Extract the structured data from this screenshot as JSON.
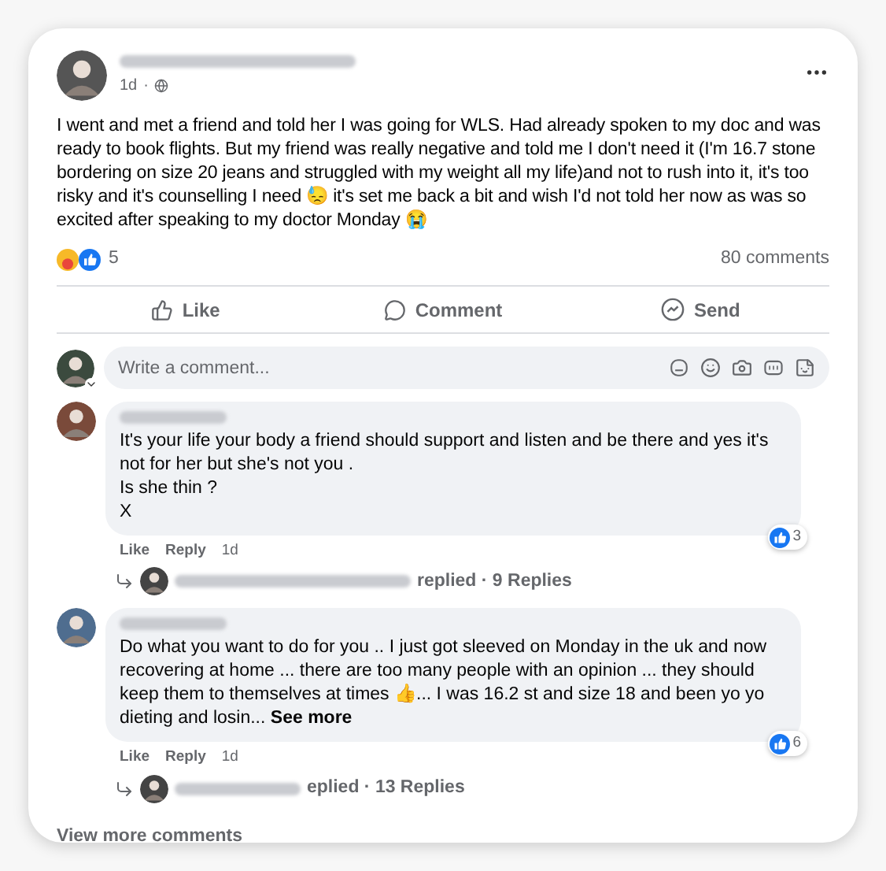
{
  "post": {
    "time": "1d",
    "separator": "·",
    "text": "I went and met a friend and told her I was going for WLS. Had already spoken to my doc and was ready to book flights. But my friend was really negative and told me I don't need it (I'm 16.7 stone bordering on size 20 jeans and struggled with my weight all my life)and not to rush into it, it's too risky and it's counselling I need 😓 it's set me back a bit and wish I'd not told her now as was so excited after speaking to my doctor Monday 😭",
    "reaction_count": "5",
    "comment_count": "80 comments"
  },
  "actions": [
    "Like",
    "Comment",
    "Send"
  ],
  "composer": {
    "placeholder": "Write a comment..."
  },
  "comments": [
    {
      "lines": [
        "It's your life your body a friend should support and listen and be there and yes it's not for her but she's not you .",
        "Is she thin ?",
        "X"
      ],
      "like": "Like",
      "reply": "Reply",
      "time": "1d",
      "reactions": "3",
      "replies": "replied · 9 Replies"
    },
    {
      "lines": [
        "Do what you want to do for you .. I just got sleeved on Monday in the uk and now recovering at home ... there are too many people with an opinion ... they should keep them to themselves at times 👍... I was 16.2 st and size 18 and been yo yo dieting and losin..."
      ],
      "see_more": "See more",
      "like": "Like",
      "reply": "Reply",
      "time": "1d",
      "reactions": "6",
      "replies": "eplied · 13 Replies"
    }
  ],
  "view_more": "View more comments"
}
